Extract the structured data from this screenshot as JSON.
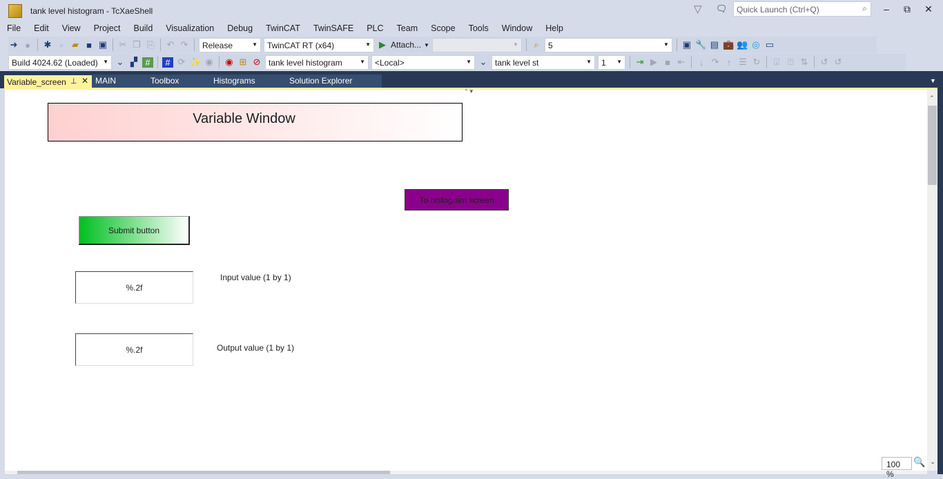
{
  "window": {
    "title": "tank level histogram - TcXaeShell",
    "quick_launch_placeholder": "Quick Launch (Ctrl+Q)"
  },
  "menu": [
    "File",
    "Edit",
    "View",
    "Project",
    "Build",
    "Visualization",
    "Debug",
    "TwinCAT",
    "TwinSAFE",
    "PLC",
    "Team",
    "Scope",
    "Tools",
    "Window",
    "Help"
  ],
  "toolbar1": {
    "config": "Release",
    "platform": "TwinCAT RT (x64)",
    "attach": "Attach...",
    "find_value": "5"
  },
  "toolbar2": {
    "build": "Build 4024.62 (Loaded)",
    "project": "tank level histogram",
    "target": "<Local>",
    "task": "tank level st",
    "instance": "1"
  },
  "tabs": [
    {
      "label": "Variable_screen",
      "active": true
    },
    {
      "label": "MAIN"
    },
    {
      "label": "Toolbox"
    },
    {
      "label": "Histograms"
    },
    {
      "label": "Solution Explorer"
    }
  ],
  "canvas": {
    "header": "Variable Window",
    "histogram_button": "To histogram screen",
    "submit_button": "Submit button",
    "input_box": "%.2f",
    "input_label": "Input value (1 by 1)",
    "output_box": "%.2f",
    "output_label": "Output value (1 by 1)"
  },
  "zoom": "100 %",
  "colors": {
    "tab_active": "#fff29d",
    "tabstrip": "#293955",
    "purple_button": "#8b008b",
    "green_button": "#00c020"
  }
}
